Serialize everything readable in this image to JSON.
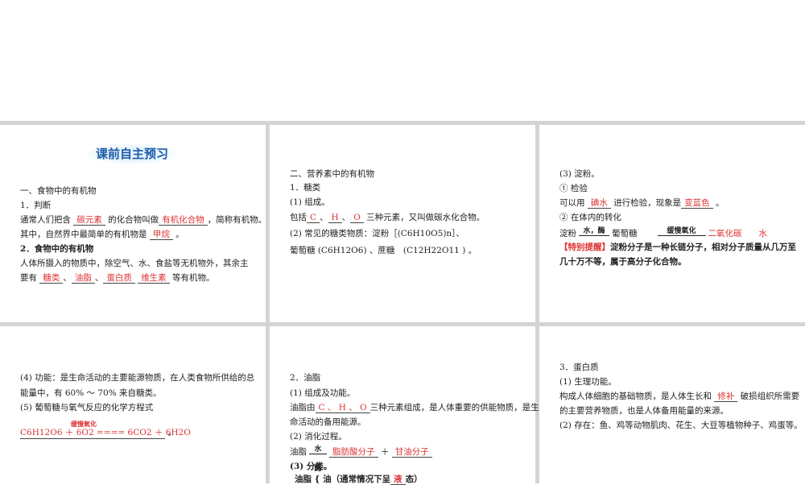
{
  "title": "课前自主预习",
  "p1": {
    "h": "一、食物中的有机物",
    "l1": "1．判断",
    "l2a": "通常人们把含",
    "a1": "碳元素",
    "l2b": "的化合物叫做",
    "a2": "有机化合物",
    "l2c": "，简称有机物。",
    "l3a": "其中，自然界中最简单的有机物是",
    "a3": "甲烷",
    "l3b": "。",
    "l4": "2．食物中的有机物",
    "l5": "人体所摄入的物质中，除空气、水、食盐等无机物外，其余主",
    "l6a": "要有",
    "a4": "糖类",
    "s1": "、",
    "a5": "油脂",
    "s2": "、",
    "a6": "蛋白质",
    "a7": "维生素",
    "l6b": "等有机物。"
  },
  "p2": {
    "h": "二、营养素中的有机物",
    "l1": "1．糖类",
    "l2": "(1) 组成。",
    "l3a": "包括",
    "c": "C",
    "s": "、",
    "h2": "H",
    "o": "O",
    "l3b": "三种元素，又叫做碳水化合物。",
    "l4": "(2) 常见的糖类物质：淀粉［(C6H10O5)n］、",
    "l5": "葡萄糖 (C6H12O6) 、蔗糖　(C12H22O11 ) 。"
  },
  "p3": {
    "l1": "(3) 淀粉。",
    "l2": "① 检验",
    "l3a": "可以用",
    "a1": "碘水",
    "l3b": "进行检验，现象是",
    "a2": "变蓝色",
    "l3c": "。",
    "l4": "② 在体内的转化",
    "l5a": "淀粉",
    "arr1": "水，酶",
    "l5b": "葡萄糖",
    "arr2": "缓慢氧化",
    "a3": "二氧化碳",
    "a4": "水",
    "tip": "【特别提醒】",
    "l6": "淀粉分子是一种长链分子，相对分子质量从几万至",
    "l7": "几十万不等，属于高分子化合物。"
  },
  "p4": {
    "l1": "(4) 功能：是生命活动的主要能源物质，在人类食物所供给的总",
    "l2": "能量中，有 60% ～ 70% 来自糖类。",
    "l3": "(5) 葡萄糖与氧气反应的化学方程式",
    "cond": "缓慢氧化",
    "eq": "C6H12O6 ＋ 6O2 ==== 6CO2 ＋ 6H2O",
    "end": "。"
  },
  "p5": {
    "l1": "2．油脂",
    "l2": "(1) 组成及功能。",
    "l3a": "油脂由",
    "a1": "C 、 H 、 O",
    "l3b": "三种元素组成，是人体重要的供能物质，是生",
    "l4": "命活动的备用能源。",
    "l5": "(2) 消化过程。",
    "l6a": "油脂",
    "arr": "水",
    "arrb": "酶",
    "a2": "脂肪酸分子",
    "a3": "甘油分子",
    "l7": "(3) 分类。",
    "l8a": "油脂",
    "l8b": "油（通常情况下呈",
    "a4": "液",
    "l8c": "态）"
  },
  "p6": {
    "l1": "3．蛋白质",
    "l2": "(1) 生理功能。",
    "l3a": "构成人体细胞的基础物质，是人体生长和",
    "a1": "修补",
    "l3b": "破损组织所需要",
    "l4": "的主要营养物质，也是人体备用能量的来源。",
    "l5": "(2) 存在：鱼、鸡等动物肌肉、花生、大豆等植物种子、鸡蛋等。"
  }
}
